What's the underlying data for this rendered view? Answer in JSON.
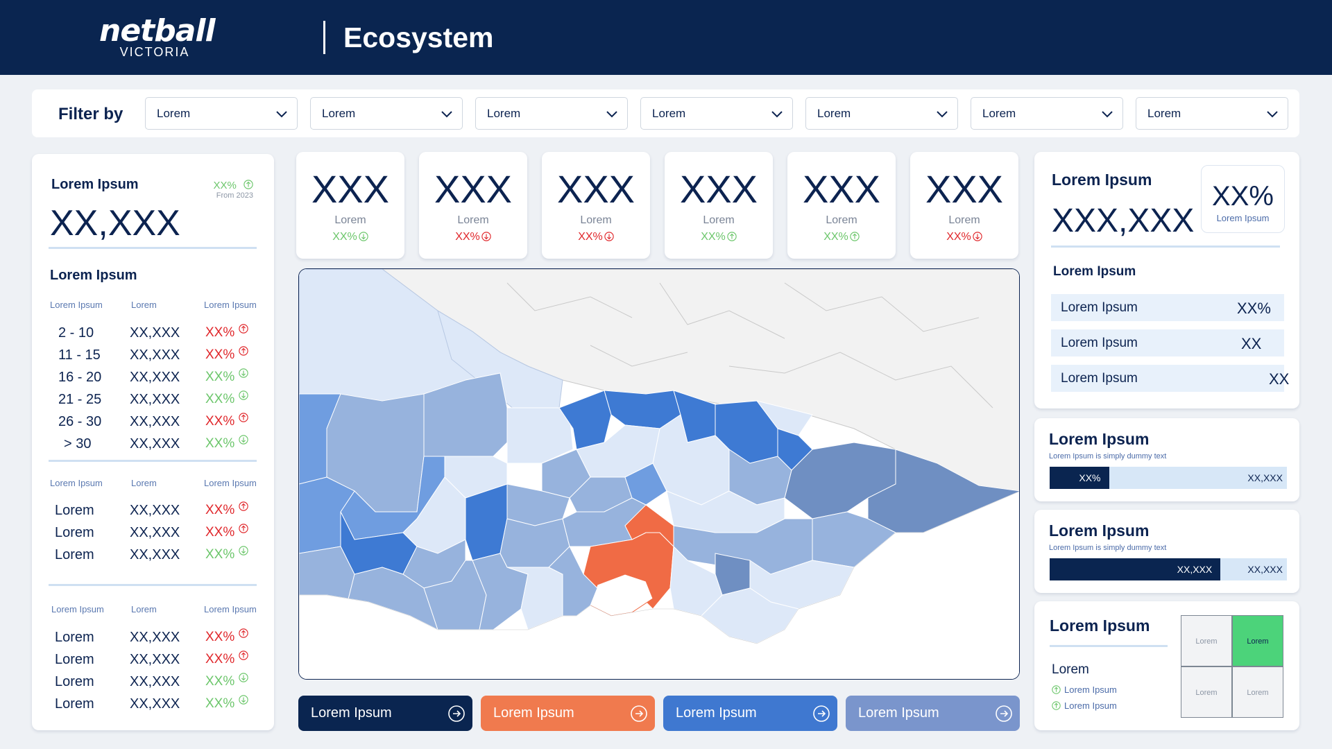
{
  "header": {
    "logo_main": "netball",
    "logo_sub": "VICTORIA",
    "title": "Ecosystem"
  },
  "filters": {
    "label": "Filter by",
    "dropdowns": [
      "Lorem",
      "Lorem",
      "Lorem",
      "Lorem",
      "Lorem",
      "Lorem",
      "Lorem"
    ]
  },
  "left_panel": {
    "title": "Lorem Ipsum",
    "change": "XX%",
    "change_sub": "From 2023",
    "big_value": "XX,XXX",
    "section1": {
      "title": "Lorem Ipsum",
      "headers": [
        "Lorem Ipsum",
        "Lorem",
        "Lorem Ipsum"
      ],
      "rows": [
        {
          "label": "2 - 10",
          "value": "XX,XXX",
          "pct": "XX%",
          "trend": "up"
        },
        {
          "label": "11 - 15",
          "value": "XX,XXX",
          "pct": "XX%",
          "trend": "up"
        },
        {
          "label": "16 - 20",
          "value": "XX,XXX",
          "pct": "XX%",
          "trend": "down"
        },
        {
          "label": "21 - 25",
          "value": "XX,XXX",
          "pct": "XX%",
          "trend": "down"
        },
        {
          "label": "26 - 30",
          "value": "XX,XXX",
          "pct": "XX%",
          "trend": "up"
        },
        {
          "label": "> 30",
          "value": "XX,XXX",
          "pct": "XX%",
          "trend": "down"
        }
      ]
    },
    "section2": {
      "headers": [
        "Lorem Ipsum",
        "Lorem",
        "Lorem Ipsum"
      ],
      "rows": [
        {
          "label": "Lorem",
          "value": "XX,XXX",
          "pct": "XX%",
          "trend": "up"
        },
        {
          "label": "Lorem",
          "value": "XX,XXX",
          "pct": "XX%",
          "trend": "up"
        },
        {
          "label": "Lorem",
          "value": "XX,XXX",
          "pct": "XX%",
          "trend": "down"
        }
      ]
    },
    "section3": {
      "headers": [
        "Lorem Ipsum",
        "Lorem",
        "Lorem Ipsum"
      ],
      "rows": [
        {
          "label": "Lorem",
          "value": "XX,XXX",
          "pct": "XX%",
          "trend": "up"
        },
        {
          "label": "Lorem",
          "value": "XX,XXX",
          "pct": "XX%",
          "trend": "up"
        },
        {
          "label": "Lorem",
          "value": "XX,XXX",
          "pct": "XX%",
          "trend": "down"
        },
        {
          "label": "Lorem",
          "value": "XX,XXX",
          "pct": "XX%",
          "trend": "down"
        }
      ]
    }
  },
  "kpis": [
    {
      "value": "XXX",
      "label": "Lorem",
      "change": "XX%",
      "color": "green",
      "icon": "arrow-down-circle-icon"
    },
    {
      "value": "XXX",
      "label": "Lorem",
      "change": "XX%",
      "color": "red",
      "icon": "arrow-down-circle-icon"
    },
    {
      "value": "XXX",
      "label": "Lorem",
      "change": "XX%",
      "color": "red",
      "icon": "arrow-down-circle-icon"
    },
    {
      "value": "XXX",
      "label": "Lorem",
      "change": "XX%",
      "color": "green",
      "icon": "arrow-up-circle-icon"
    },
    {
      "value": "XXX",
      "label": "Lorem",
      "change": "XX%",
      "color": "green",
      "icon": "arrow-up-circle-icon"
    },
    {
      "value": "XXX",
      "label": "Lorem",
      "change": "XX%",
      "color": "red",
      "icon": "arrow-down-circle-icon"
    }
  ],
  "map": {
    "description_colors": {
      "highlight": "#f06b45",
      "dark": "#3e7ad3",
      "mid": "#97b3dd",
      "light": "#dde8f8",
      "slate": "#6f8fc2",
      "outside": "#f2f2f2"
    }
  },
  "buttons": [
    {
      "label": "Lorem Ipsum",
      "color": "#0a2550"
    },
    {
      "label": "Lorem Ipsum",
      "color": "#f07a4e"
    },
    {
      "label": "Lorem Ipsum",
      "color": "#3f78d0"
    },
    {
      "label": "Lorem Ipsum",
      "color": "#7a95cc"
    }
  ],
  "right_panel": {
    "title": "Lorem Ipsum",
    "big_value": "XXX,XXX",
    "pct_value": "XX%",
    "pct_sub": "Lorem Ipsum",
    "sub_title": "Lorem Ipsum",
    "rows": [
      {
        "label": "Lorem Ipsum",
        "value": "XX%"
      },
      {
        "label": "Lorem Ipsum",
        "value": "XX"
      },
      {
        "label": "Lorem Ipsum",
        "value": "XX"
      }
    ]
  },
  "bar_card_1": {
    "title": "Lorem Ipsum",
    "subtitle": "Lorem Ipsum is simply dummy text",
    "fill_text": "XX%",
    "track_text": "XX,XXX",
    "fill_fraction": 0.25
  },
  "bar_card_2": {
    "title": "Lorem Ipsum",
    "subtitle": "Lorem Ipsum is simply dummy text",
    "fill_text": "XX,XXX",
    "track_text": "XX,XXX",
    "fill_fraction": 0.72
  },
  "matrix_card": {
    "title": "Lorem Ipsum",
    "sub_title": "Lorem",
    "items": [
      "Lorem Ipsum",
      "Lorem Ipsum"
    ],
    "cells": [
      "Lorem",
      "Lorem",
      "Lorem",
      "Lorem"
    ],
    "highlight_color": "#4cd37a"
  }
}
